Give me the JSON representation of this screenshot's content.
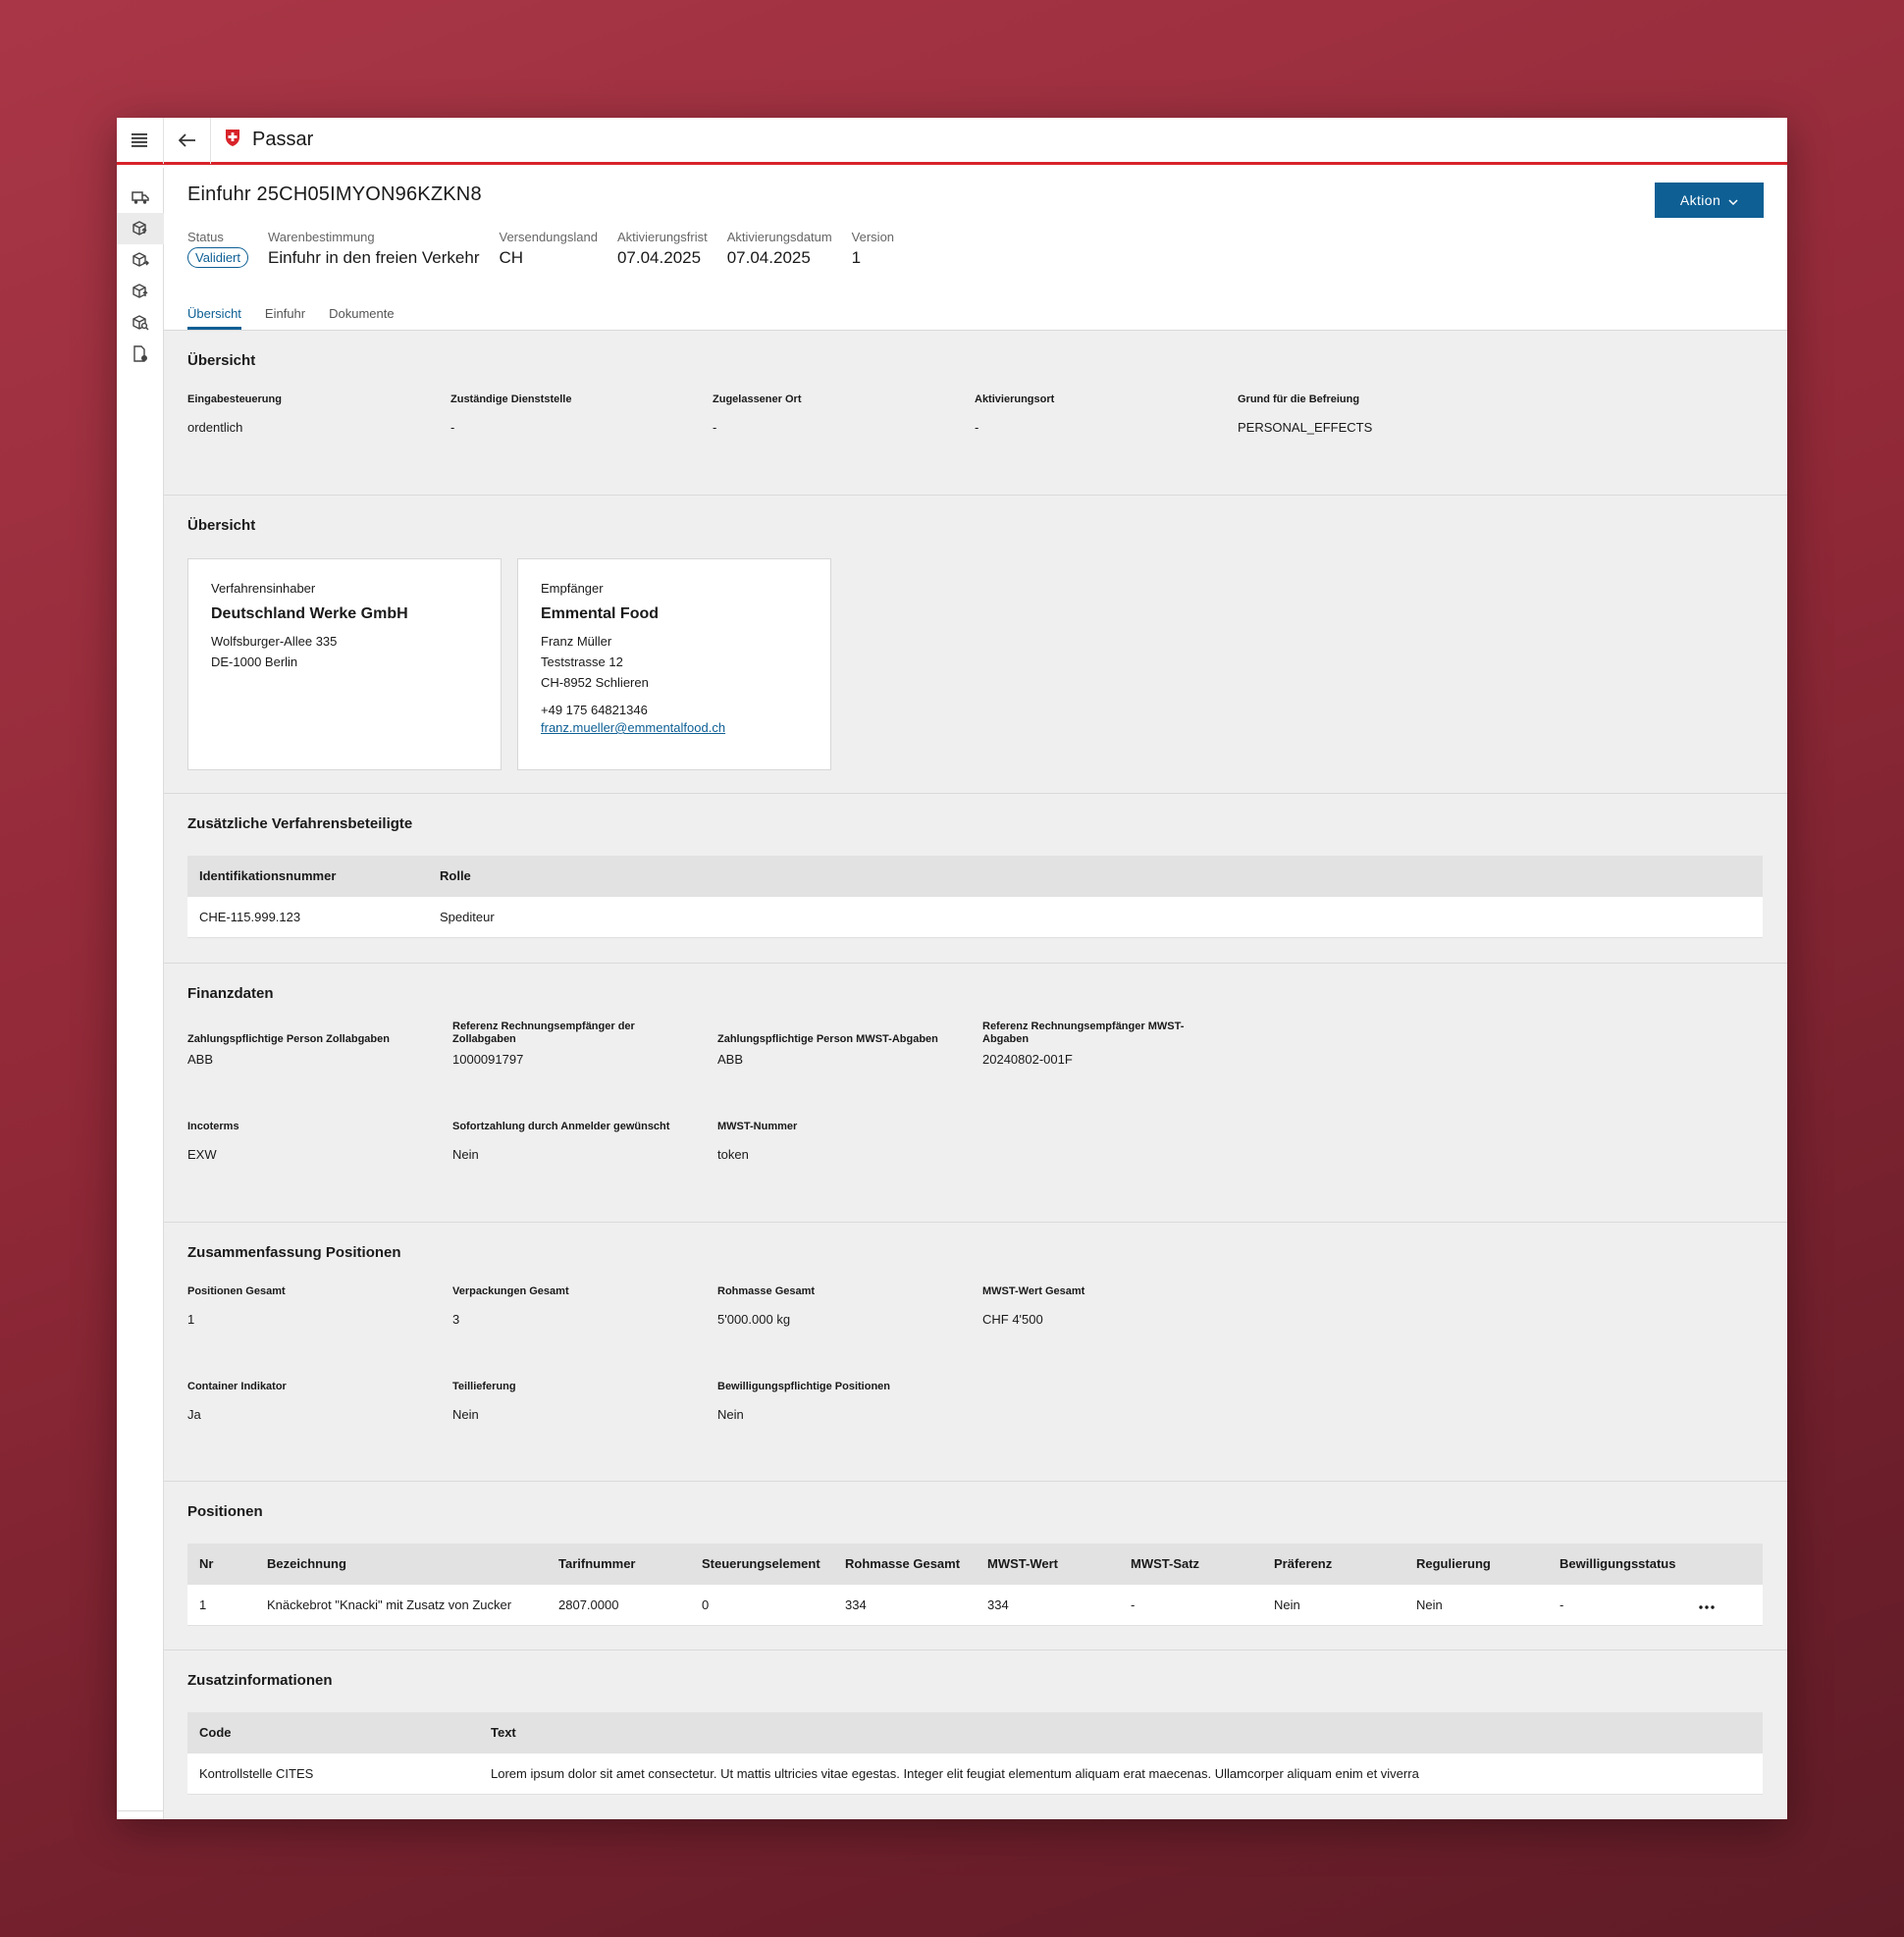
{
  "app": {
    "name": "Passar"
  },
  "header": {
    "title": "Einfuhr 25CH05IMYON96KZKN8",
    "action_label": "Aktion",
    "meta": [
      {
        "label": "Status",
        "value": "Validiert"
      },
      {
        "label": "Warenbestimmung",
        "value": "Einfuhr in den freien Verkehr"
      },
      {
        "label": "Versendungsland",
        "value": "CH"
      },
      {
        "label": "Aktivierungsfrist",
        "value": "07.04.2025"
      },
      {
        "label": "Aktivierungsdatum",
        "value": "07.04.2025"
      },
      {
        "label": "Version",
        "value": "1"
      }
    ],
    "tabs": [
      "Übersicht",
      "Einfuhr",
      "Dokumente"
    ]
  },
  "overview": {
    "title": "Übersicht",
    "fields": [
      {
        "label": "Eingabesteuerung",
        "value": "ordentlich"
      },
      {
        "label": "Zuständige Dienststelle",
        "value": "-"
      },
      {
        "label": "Zugelassener Ort",
        "value": "-"
      },
      {
        "label": "Aktivierungsort",
        "value": "-"
      },
      {
        "label": "Grund für die Befreiung",
        "value": "PERSONAL_EFFECTS"
      }
    ]
  },
  "parties": {
    "title": "Übersicht",
    "holder": {
      "label": "Verfahrensinhaber",
      "name": "Deutschland Werke GmbH",
      "street": "Wolfsburger-Allee 335",
      "city": "DE-1000 Berlin"
    },
    "recipient": {
      "label": "Empfänger",
      "name": "Emmental Food",
      "contact": "Franz Müller",
      "street": "Teststrasse 12",
      "city": "CH-8952 Schlieren",
      "phone": "+49 175 64821346",
      "email": "franz.mueller@emmentalfood.ch"
    }
  },
  "additional_parties": {
    "title": "Zusätzliche Verfahrensbeteiligte",
    "headers": [
      "Identifikationsnummer",
      "Rolle"
    ],
    "rows": [
      [
        "CHE-115.999.123",
        "Spediteur"
      ]
    ]
  },
  "finance": {
    "title": "Finanzdaten",
    "row1": [
      {
        "label": "Zahlungspflichtige Person Zollabgaben",
        "value": "ABB"
      },
      {
        "label": "Referenz Rechnungsempfänger der Zollabgaben",
        "value": "1000091797"
      },
      {
        "label": "Zahlungspflichtige Person MWST-Abgaben",
        "value": "ABB"
      },
      {
        "label": "Referenz Rechnungsempfänger MWST-Abgaben",
        "value": "20240802-001F"
      }
    ],
    "row2": [
      {
        "label": "Incoterms",
        "value": "EXW"
      },
      {
        "label": "Sofortzahlung durch Anmelder gewünscht",
        "value": "Nein"
      },
      {
        "label": "MWST-Nummer",
        "value": "token"
      }
    ]
  },
  "summary": {
    "title": "Zusammenfassung Positionen",
    "row1": [
      {
        "label": "Positionen Gesamt",
        "value": "1"
      },
      {
        "label": "Verpackungen Gesamt",
        "value": "3"
      },
      {
        "label": "Rohmasse Gesamt",
        "value": "5'000.000 kg"
      },
      {
        "label": "MWST-Wert Gesamt",
        "value": "CHF 4'500"
      }
    ],
    "row2": [
      {
        "label": "Container Indikator",
        "value": "Ja"
      },
      {
        "label": "Teillieferung",
        "value": "Nein"
      },
      {
        "label": "Bewilligungspflichtige Positionen",
        "value": "Nein"
      }
    ]
  },
  "positions": {
    "title": "Positionen",
    "headers": [
      "Nr",
      "Bezeichnung",
      "Tarifnummer",
      "Steuerungselement",
      "Rohmasse Gesamt",
      "MWST-Wert",
      "MWST-Satz",
      "Präferenz",
      "Regulierung",
      "Bewilligungsstatus"
    ],
    "rows": [
      [
        "1",
        "Knäckebrot \"Knacki\" mit Zusatz von Zucker",
        "2807.0000",
        "0",
        "334",
        "334",
        "-",
        "Nein",
        "Nein",
        "-"
      ]
    ]
  },
  "extra_info": {
    "title": "Zusatzinformationen",
    "headers": [
      "Code",
      "Text"
    ],
    "rows": [
      [
        "Kontrollstelle CITES",
        "Lorem ipsum dolor sit amet consectetur. Ut mattis ultricies vitae egestas. Integer elit feugiat elementum aliquam erat maecenas. Ullamcorper aliquam enim et viverra"
      ]
    ]
  },
  "colors": {
    "brand_red": "#d8232a",
    "primary_blue": "#0d5f94",
    "background": "#efefef"
  },
  "icons": [
    "menu-icon",
    "back-arrow-icon",
    "swiss-shield-icon",
    "chevron-down-icon",
    "more-horizontal-icon"
  ]
}
